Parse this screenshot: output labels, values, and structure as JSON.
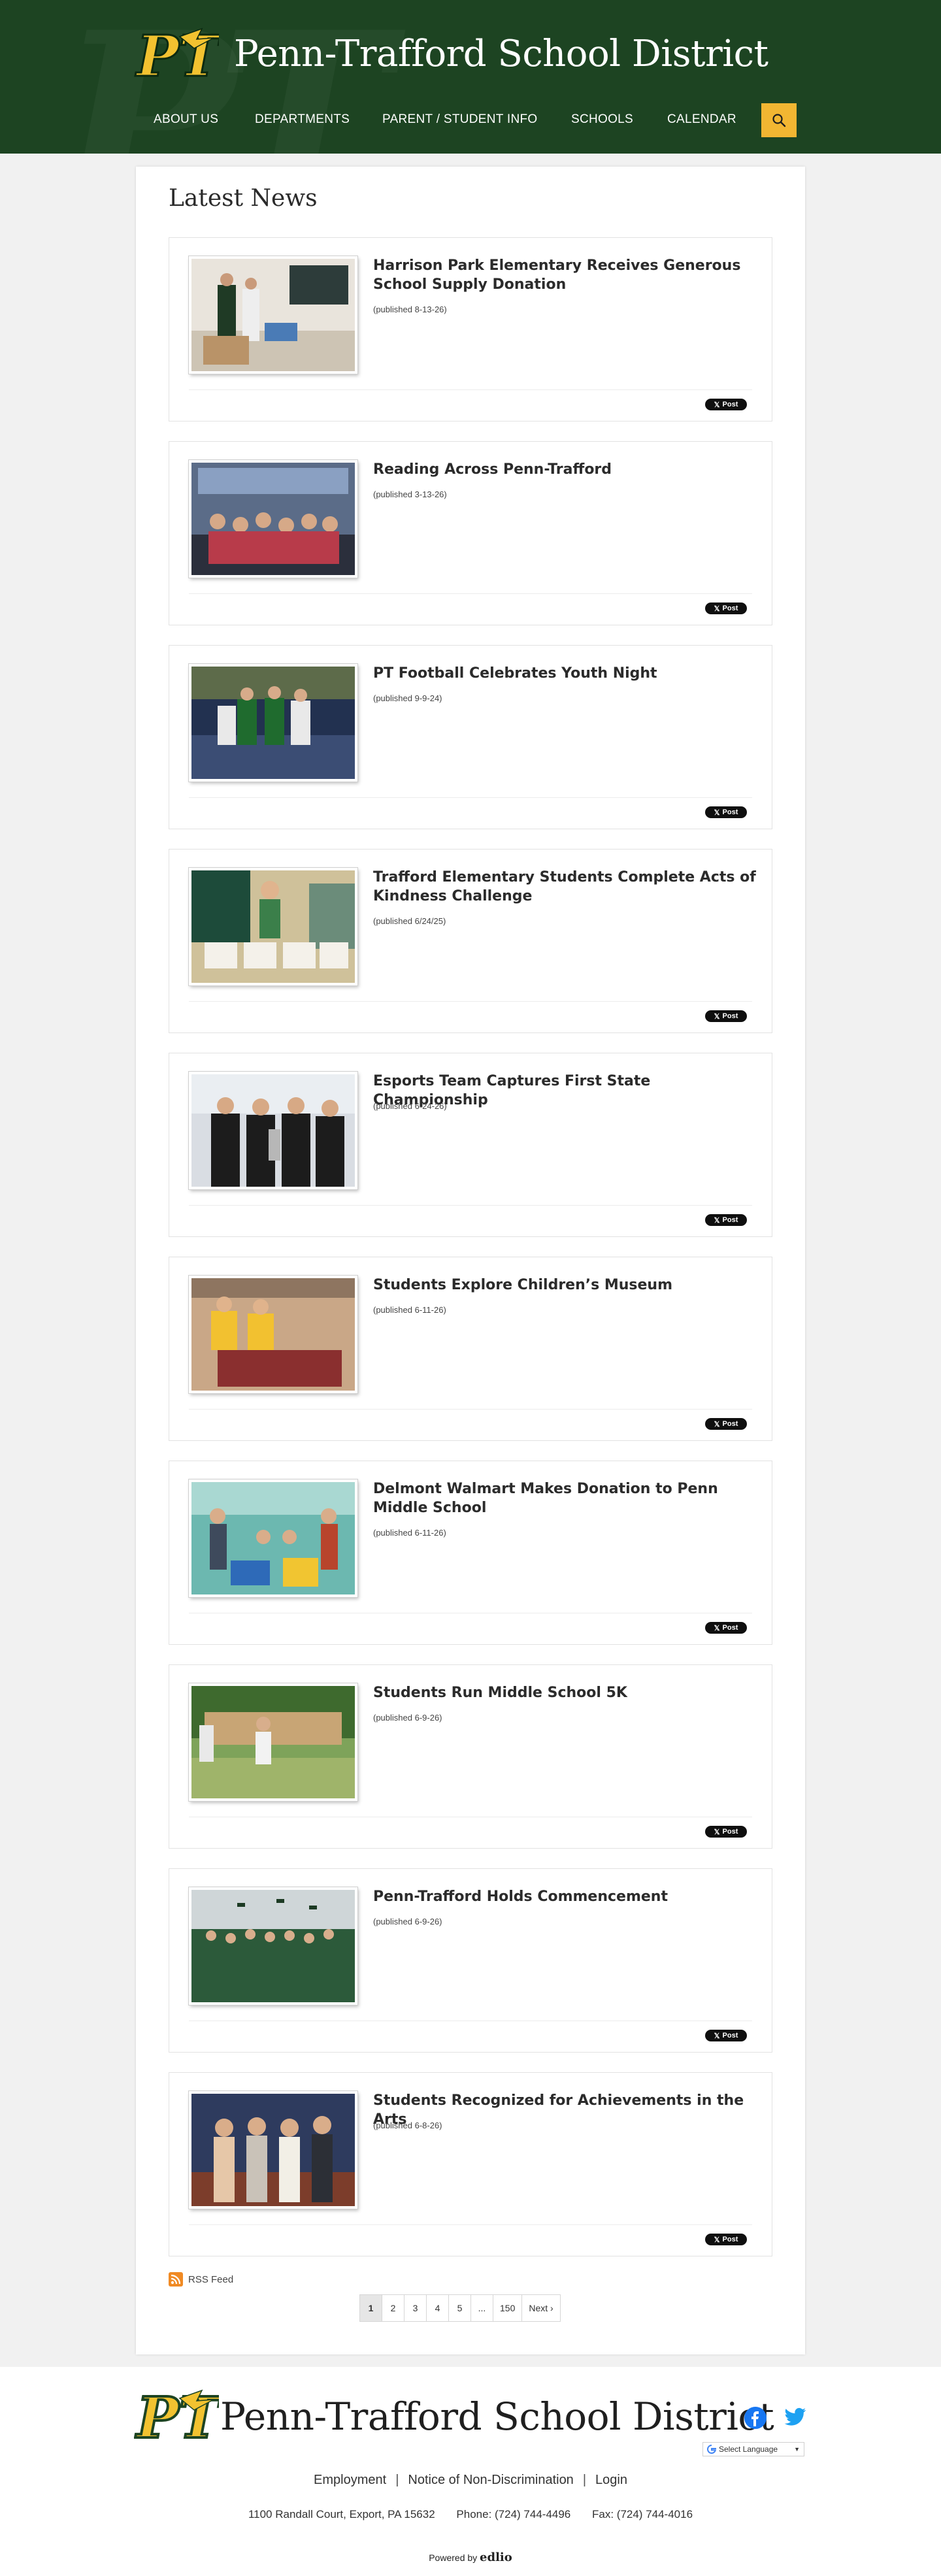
{
  "site": {
    "title": "Penn-Trafford School District",
    "logo_text": "PT"
  },
  "nav": {
    "items": [
      "ABOUT US",
      "DEPARTMENTS",
      "PARENT / STUDENT INFO",
      "SCHOOLS",
      "CALENDAR"
    ],
    "search_icon": "search-icon"
  },
  "main": {
    "title": "Latest News",
    "articles": [
      {
        "title": "Harrison Park Elementary Receives Generous School Supply Donation",
        "date": "(published 8-13-26)"
      },
      {
        "title": "Reading Across Penn-Trafford",
        "date": "(published 3-13-26)"
      },
      {
        "title": "PT Football Celebrates Youth Night",
        "date": "(published 9-9-24)"
      },
      {
        "title": "Trafford Elementary Students Complete Acts of Kindness Challenge",
        "date": "(published 6/24/25)"
      },
      {
        "title": "Esports Team Captures First State Championship",
        "date": "(published 6-24-26)"
      },
      {
        "title": "Students Explore Children’s Museum",
        "date": "(published 6-11-26)"
      },
      {
        "title": "Delmont Walmart Makes Donation to Penn Middle School",
        "date": "(published 6-11-26)"
      },
      {
        "title": "Students Run Middle School 5K",
        "date": "(published 6-9-26)"
      },
      {
        "title": "Penn-Trafford Holds Commencement",
        "date": "(published 6-9-26)"
      },
      {
        "title": "Students Recognized for Achievements in the Arts",
        "date": "(published 6-8-26)"
      }
    ],
    "post_label": "Post",
    "rss_label": "RSS Feed",
    "pagination": [
      "1",
      "2",
      "3",
      "4",
      "5",
      "...",
      "150",
      "Next ›"
    ]
  },
  "footer": {
    "title": "Penn-Trafford School District",
    "links": [
      "Employment",
      "Notice of Non-Discrimination",
      "Login"
    ],
    "address": "1100 Randall Court, Export, PA 15632",
    "phone": "Phone: (724) 744-4496",
    "fax": "Fax: (724) 744-4016",
    "translate_label": "Select Language",
    "powered_prefix": "Powered by",
    "powered_brand": "edlio"
  },
  "colors": {
    "header_bg": "#1d4422",
    "accent": "#f2b632",
    "facebook": "#1877f2",
    "twitter": "#1da1f2"
  }
}
